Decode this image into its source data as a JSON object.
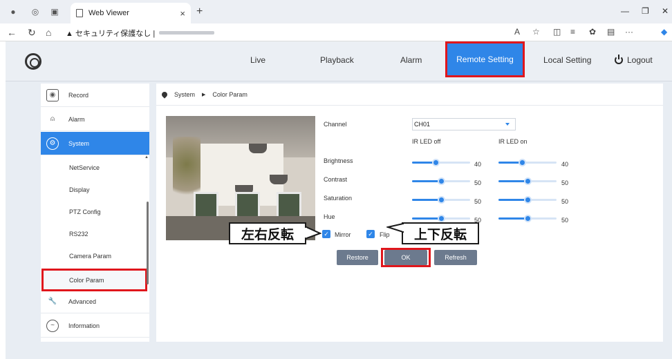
{
  "browser": {
    "tab_title": "Web Viewer",
    "tab_close": "×",
    "new_tab": "+",
    "security_warning": "▲ セキュリティ保護なし |",
    "window_minimize": "—",
    "window_restore": "❐",
    "window_close": "✕"
  },
  "header": {
    "menu": [
      {
        "label": "Live"
      },
      {
        "label": "Playback"
      },
      {
        "label": "Alarm"
      },
      {
        "label": "Remote Setting"
      },
      {
        "label": "Local Setting"
      }
    ],
    "logout_label": "Logout"
  },
  "sidebar": {
    "items": [
      {
        "label": "Record",
        "icon": "camera-icon"
      },
      {
        "label": "Alarm",
        "icon": "alarm-icon"
      },
      {
        "label": "System",
        "icon": "gear-icon"
      },
      {
        "label": "Advanced",
        "icon": "wrench-icon"
      },
      {
        "label": "Information",
        "icon": "info-icon"
      }
    ],
    "sub_items": [
      {
        "label": "NetService"
      },
      {
        "label": "Display"
      },
      {
        "label": "PTZ Config"
      },
      {
        "label": "RS232"
      },
      {
        "label": "Camera Param"
      },
      {
        "label": "Color Param"
      }
    ]
  },
  "breadcrumb": {
    "section": "System",
    "page": "Color Param"
  },
  "color_param": {
    "channel_label": "Channel",
    "channel_value": "CH01",
    "col_ir_off": "IR LED off",
    "col_ir_on": "IR LED on",
    "rows": [
      {
        "label": "Brightness",
        "off_value": "40",
        "on_value": "40",
        "off_level": 0.4,
        "on_level": 0.4
      },
      {
        "label": "Contrast",
        "off_value": "50",
        "on_value": "50",
        "off_level": 0.5,
        "on_level": 0.5
      },
      {
        "label": "Saturation",
        "off_value": "50",
        "on_value": "50",
        "off_level": 0.5,
        "on_level": 0.5
      },
      {
        "label": "Hue",
        "off_value": "50",
        "on_value": "50",
        "off_level": 0.5,
        "on_level": 0.5
      }
    ],
    "mirror_label": "Mirror",
    "flip_label": "Flip",
    "mirror_checked": true,
    "flip_checked": true,
    "restore_label": "Restore",
    "ok_label": "OK",
    "refresh_label": "Refresh"
  },
  "annotations": {
    "mirror_callout": "左右反転",
    "flip_callout": "上下反転"
  },
  "colors": {
    "accent": "#2f86e8",
    "highlight_frame": "#e0161c"
  }
}
